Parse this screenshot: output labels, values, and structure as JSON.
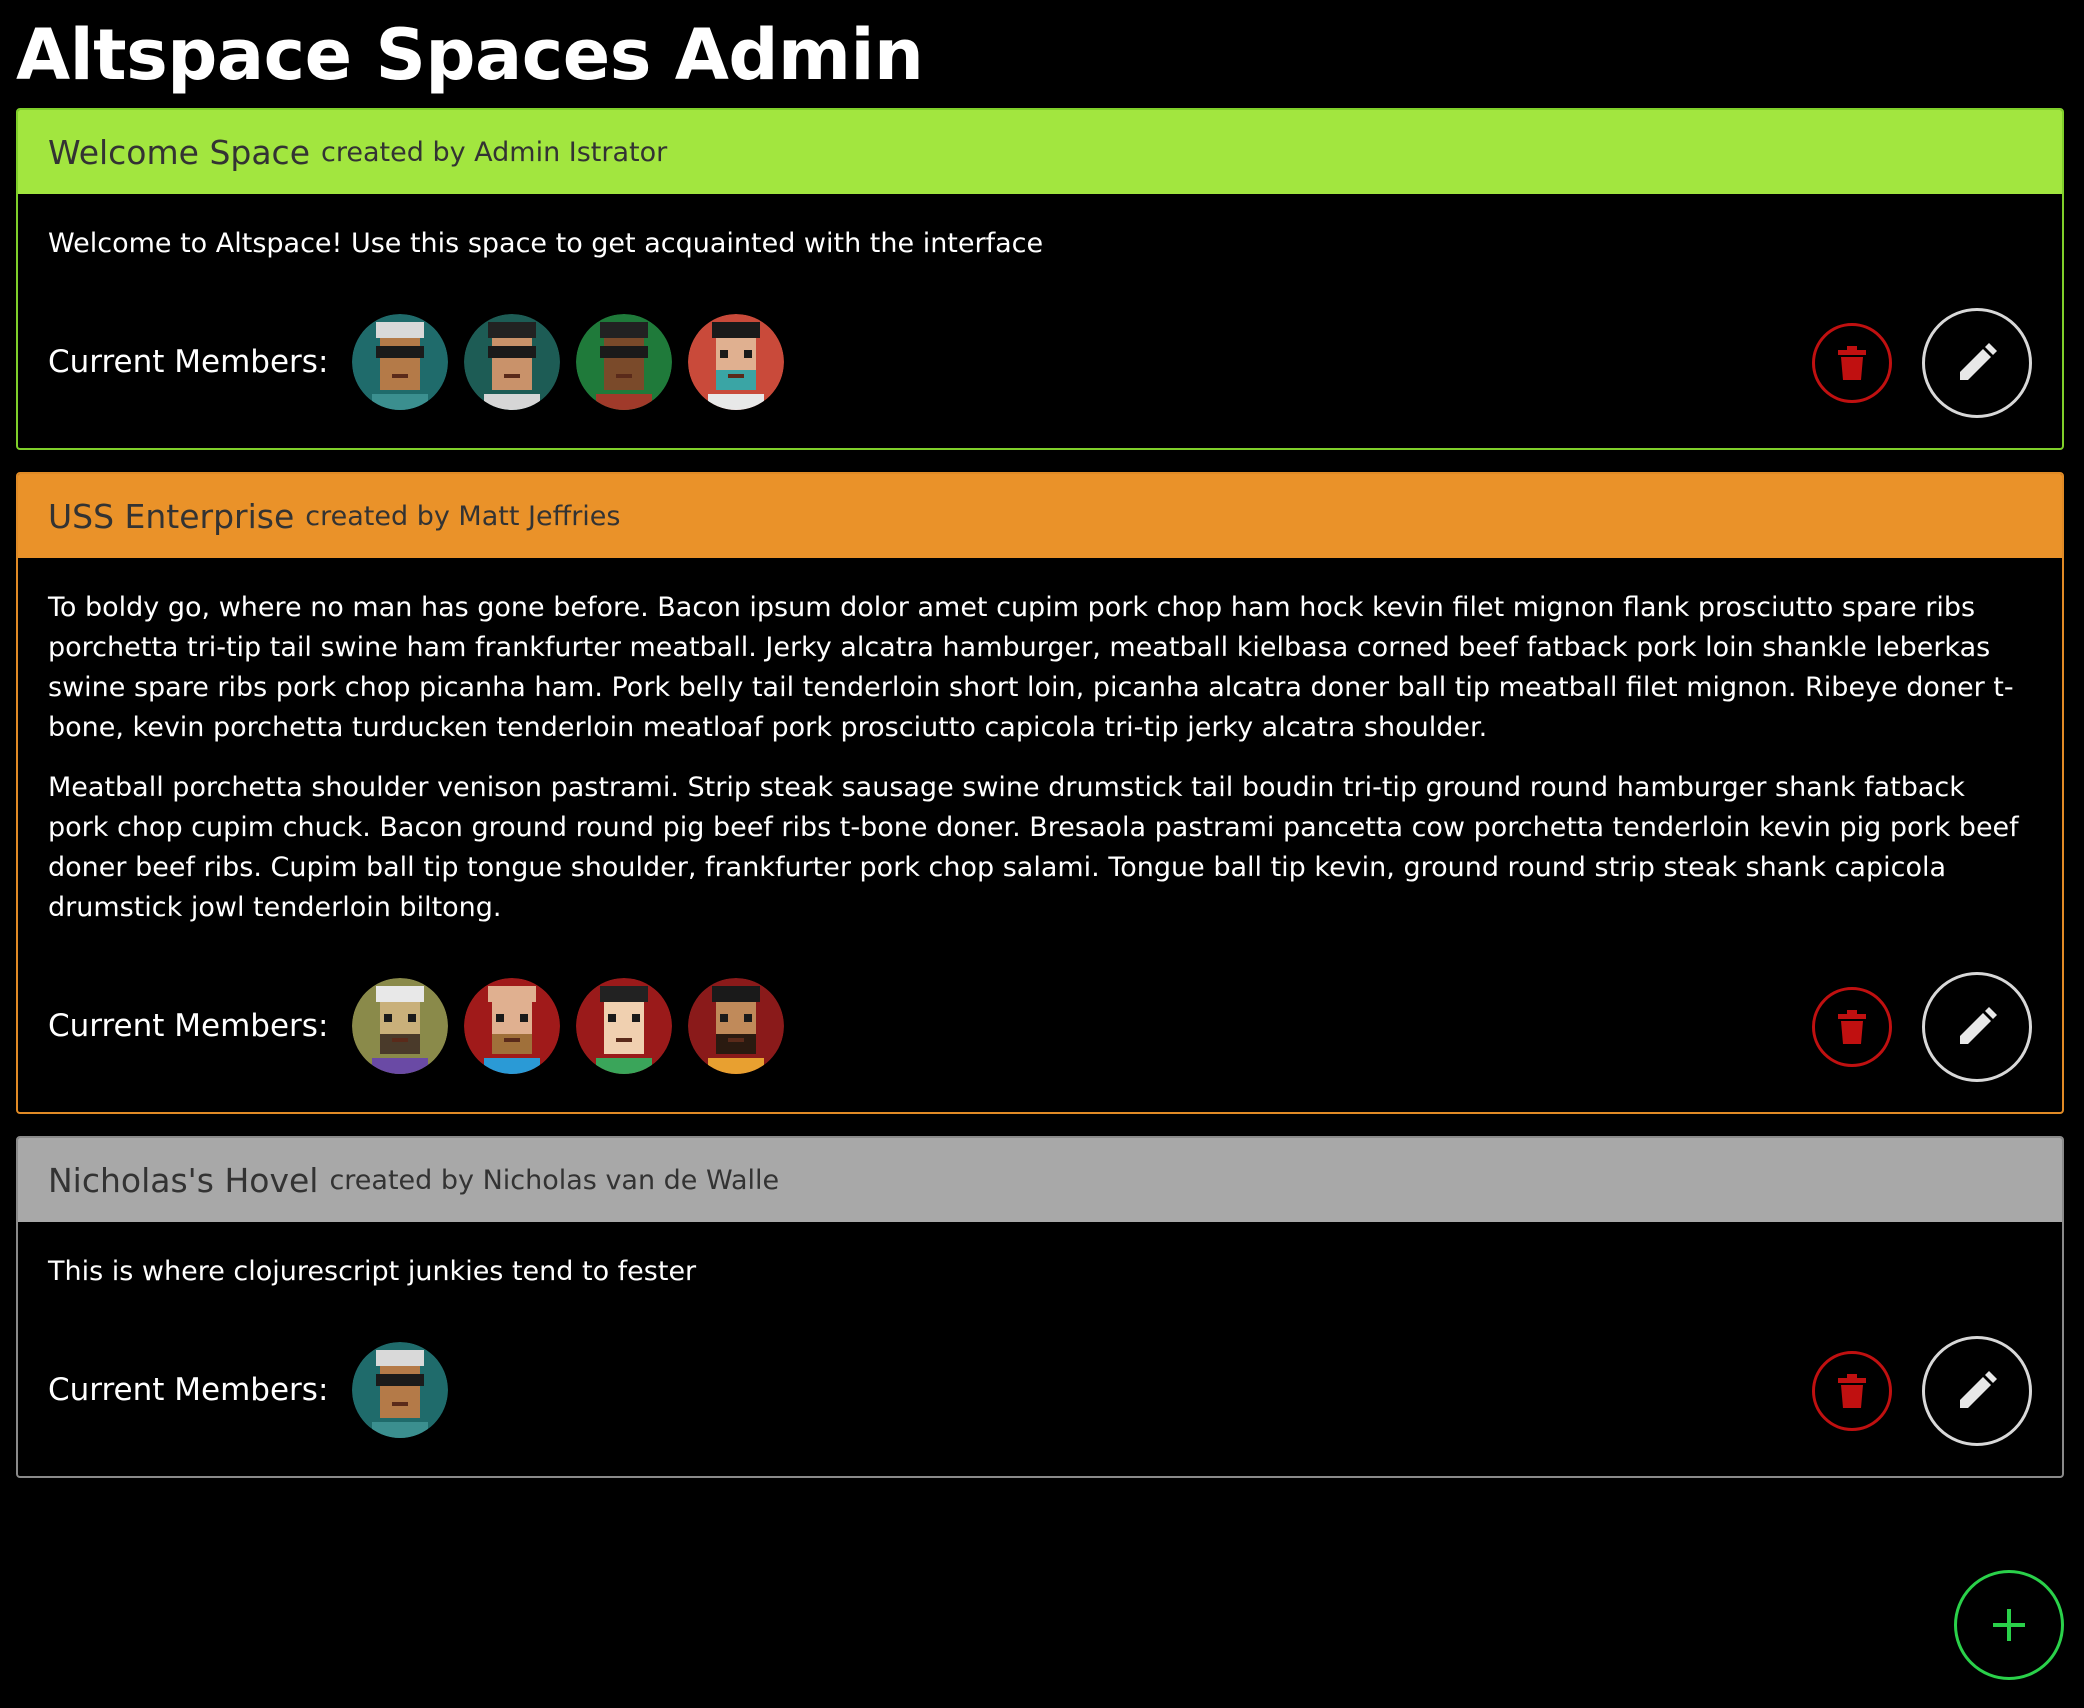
{
  "app": {
    "title": "Altspace Spaces Admin"
  },
  "spaces": [
    {
      "name": "Welcome Space",
      "created_by": "created by Admin Istrator",
      "header_color": "#a2e63f",
      "border_color": "#7fcf2a",
      "paragraphs": [
        "Welcome to Altspace! Use this space to get acquainted with the interface"
      ],
      "members_label": "Current Members:",
      "members": [
        {
          "bg": "#1f6b6b",
          "hair": "#d9d9d9",
          "skin": "#b47a48",
          "shirt": "#3b8f8f",
          "glasses": true
        },
        {
          "bg": "#1d5c55",
          "hair": "#222222",
          "skin": "#c9926a",
          "shirt": "#d6d6d6",
          "glasses": true
        },
        {
          "bg": "#1f7a3a",
          "hair": "#222222",
          "skin": "#7a4a2a",
          "shirt": "#a03a2a",
          "glasses": true
        },
        {
          "bg": "#c94a3a",
          "hair": "#1a1a1a",
          "skin": "#e0b090",
          "shirt": "#e8e8e8",
          "glasses": false,
          "beard": "#3aa5a5"
        }
      ]
    },
    {
      "name": "USS Enterprise",
      "created_by": "created by Matt Jeffries",
      "header_color": "#ea9229",
      "border_color": "#e08a25",
      "paragraphs": [
        "To boldy go, where no man has gone before. Bacon ipsum dolor amet cupim pork chop ham hock kevin filet mignon flank prosciutto spare ribs porchetta tri-tip tail swine ham frankfurter meatball. Jerky alcatra hamburger, meatball kielbasa corned beef fatback pork loin shankle leberkas swine spare ribs pork chop picanha ham. Pork belly tail tenderloin short loin, picanha alcatra doner ball tip meatball filet mignon. Ribeye doner t-bone, kevin porchetta turducken tenderloin meatloaf pork prosciutto capicola tri-tip jerky alcatra shoulder.",
        "Meatball porchetta shoulder venison pastrami. Strip steak sausage swine drumstick tail boudin tri-tip ground round hamburger shank fatback pork chop cupim chuck. Bacon ground round pig beef ribs t-bone doner. Bresaola pastrami pancetta cow porchetta tenderloin kevin pig pork beef doner beef ribs. Cupim ball tip tongue shoulder, frankfurter pork chop salami. Tongue ball tip kevin, ground round strip steak shank capicola drumstick jowl tenderloin biltong."
      ],
      "members_label": "Current Members:",
      "members": [
        {
          "bg": "#8a8a4a",
          "hair": "#e8e8e8",
          "skin": "#c9b07a",
          "shirt": "#6a4aa5",
          "glasses": false,
          "beard": "#4a3a2a"
        },
        {
          "bg": "#a01a1a",
          "hair": "#e0b090",
          "skin": "#e0b090",
          "shirt": "#2a9ad6",
          "glasses": false,
          "beard": "#a0703a"
        },
        {
          "bg": "#9a1a1a",
          "hair": "#222222",
          "skin": "#f0d0b0",
          "shirt": "#3aa55a",
          "glasses": false
        },
        {
          "bg": "#8a1a1a",
          "hair": "#1a1a1a",
          "skin": "#c08a5a",
          "shirt": "#e8a030",
          "glasses": false,
          "beard": "#2a1a10"
        }
      ]
    },
    {
      "name": "Nicholas's Hovel",
      "created_by": "created by Nicholas van de Walle",
      "header_color": "#a8a8a8",
      "border_color": "#8a8a8a",
      "paragraphs": [
        "This is where clojurescript junkies tend to fester"
      ],
      "members_label": "Current Members:",
      "members": [
        {
          "bg": "#1f6b6b",
          "hair": "#d9d9d9",
          "skin": "#b47a48",
          "shirt": "#3b8f8f",
          "glasses": true
        }
      ]
    }
  ],
  "icons": {
    "delete": "trash-icon",
    "edit": "pencil-icon",
    "add": "plus-icon"
  },
  "colors": {
    "delete": "#c01010",
    "edit": "#d8d8d8",
    "add": "#2ad14a"
  }
}
